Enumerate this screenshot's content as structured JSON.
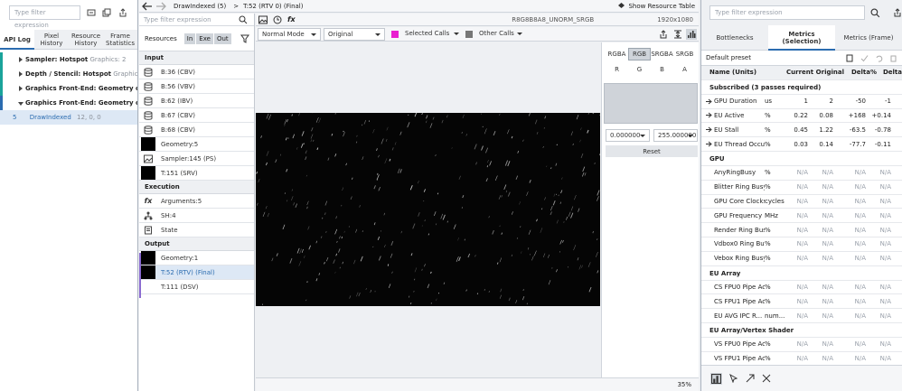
{
  "left": {
    "filter_placeholder": "Type filter expression",
    "tabs": [
      {
        "label": "API Log"
      },
      {
        "label": "Pixel History"
      },
      {
        "label": "Resource History"
      },
      {
        "label": "Frame Statistics"
      }
    ],
    "tree": [
      {
        "title": "Sampler: Hotspot",
        "detail": "Graphics: 2",
        "mark": "#1aa39a"
      },
      {
        "title": "Depth / Stencil: Hotspot",
        "detail": "Graphic...",
        "mark": "#1aa39a"
      },
      {
        "title": "Graphics Front-End: Geometry o...",
        "detail": "",
        "mark": "#1aa39a"
      },
      {
        "title": "Graphics Front-End: Geometry o...",
        "detail": "",
        "mark": "#2b6cb0"
      }
    ],
    "selected": {
      "index": "5",
      "name": "DrawIndexed",
      "args": "12, 0, 0"
    }
  },
  "center": {
    "breadcrumb_1": "DrawIndexed (5)",
    "breadcrumb_sep": ">",
    "breadcrumb_2": "T:52 (RTV 0) (Final)",
    "show_resource_table": "Show Resource Table",
    "filter_placeholder": "Type filter expression",
    "format": "R8G8B8A8_UNORM_SRGB",
    "resolution": "1920x1080",
    "resources_label": "Resources",
    "toggles": [
      "In",
      "Exe",
      "Out"
    ],
    "mode": "Normal Mode",
    "original": "Original",
    "selected_calls": "Selected Calls",
    "other_calls": "Other Calls",
    "zoom": "35%"
  },
  "resources": {
    "input_header": "Input",
    "inputs": [
      "B:36 (CBV)",
      "B:56 (VBV)",
      "B:62 (IBV)",
      "B:67 (CBV)",
      "B:68 (CBV)",
      "Geometry:5",
      "Sampler:145 (PS)",
      "T:151 (SRV)"
    ],
    "execution_header": "Execution",
    "execution": [
      "Arguments:5",
      "SH:4",
      "State"
    ],
    "output_header": "Output",
    "outputs": [
      "Geometry:1",
      "T:52 (RTV) (Final)",
      "T:111 (DSV)"
    ]
  },
  "channels": {
    "modes": [
      "RGBA",
      "RGB",
      "SRGBA",
      "SRGB"
    ],
    "channels": [
      "R",
      "G",
      "B",
      "A"
    ],
    "min": "0.000000",
    "max": "255.000000",
    "reset": "Reset"
  },
  "metrics": {
    "filter_placeholder": "Type filter expression",
    "tabs": [
      {
        "label": "Bottlenecks"
      },
      {
        "label": "Metrics (Selection)"
      },
      {
        "label": "Metrics (Frame)"
      }
    ],
    "preset": "Default preset",
    "columns": [
      "Name (Units)",
      "Current",
      "Original",
      "Delta%",
      "Delta"
    ],
    "subscribed_header": "Subscribed (3 passes required)",
    "subscribed": [
      {
        "name": "GPU Duration",
        "unit": "us",
        "current": "1",
        "original": "2",
        "delta_pct": "-50",
        "delta": "-1"
      },
      {
        "name": "EU Active",
        "unit": "%",
        "current": "0.22",
        "original": "0.08",
        "delta_pct": "+168",
        "delta": "+0.14"
      },
      {
        "name": "EU Stall",
        "unit": "%",
        "current": "0.45",
        "original": "1.22",
        "delta_pct": "-63.5",
        "delta": "-0.78"
      },
      {
        "name": "EU Thread Occupan...",
        "unit": "%",
        "current": "0.03",
        "original": "0.14",
        "delta_pct": "-77.7",
        "delta": "-0.11"
      }
    ],
    "gpu_header": "GPU",
    "gpu": [
      {
        "name": "AnyRingBusy",
        "unit": "%"
      },
      {
        "name": "Blitter Ring Busy",
        "unit": "%"
      },
      {
        "name": "GPU Core Clocks",
        "unit": "cycles"
      },
      {
        "name": "GPU Frequency",
        "unit": "MHz"
      },
      {
        "name": "Render Ring Busy",
        "unit": "%"
      },
      {
        "name": "Vdbox0 Ring Busy",
        "unit": "%"
      },
      {
        "name": "Vebox Ring Busy",
        "unit": "%"
      }
    ],
    "eu_header": "EU Array",
    "eu": [
      {
        "name": "CS FPU0 Pipe Active",
        "unit": "%"
      },
      {
        "name": "CS FPU1 Pipe Active",
        "unit": "%"
      },
      {
        "name": "EU AVG IPC R...",
        "unit": "num..."
      }
    ],
    "vs_header": "EU Array/Vertex Shader",
    "vs": [
      {
        "name": "VS FPU0 Pipe Active",
        "unit": "%"
      },
      {
        "name": "VS FPU1 Pipe Active",
        "unit": "%"
      }
    ],
    "na": "N/A"
  }
}
